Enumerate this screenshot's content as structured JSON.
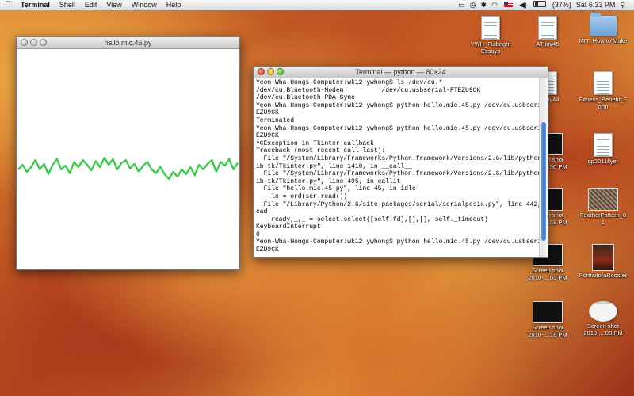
{
  "menubar": {
    "apple_glyph": "",
    "app_name": "Terminal",
    "menus": [
      "Shell",
      "Edit",
      "View",
      "Window",
      "Help"
    ],
    "battery": "(37%)",
    "clock": "Sat 6:33 PM"
  },
  "tk_window": {
    "title": "hello.mic.45.py",
    "waveform": [
      0.5,
      0.6,
      0.45,
      0.55,
      0.7,
      0.5,
      0.62,
      0.4,
      0.6,
      0.72,
      0.5,
      0.58,
      0.42,
      0.66,
      0.55,
      0.7,
      0.6,
      0.48,
      0.68,
      0.55,
      0.75,
      0.6,
      0.72,
      0.5,
      0.64,
      0.7,
      0.52,
      0.62,
      0.45,
      0.58,
      0.66,
      0.5,
      0.42,
      0.56,
      0.4,
      0.3,
      0.45,
      0.35,
      0.5,
      0.4,
      0.55,
      0.38,
      0.6,
      0.5,
      0.62,
      0.7,
      0.45,
      0.66,
      0.58,
      0.72,
      0.5,
      0.64
    ],
    "waveform_color": "#2ecc40"
  },
  "terminal": {
    "title": "Terminal — python — 80×24",
    "lines": [
      "Yeon-Wha-Hongs-Computer:wk12 ywhong$ ls /dev/cu.*",
      "/dev/cu.Bluetooth-Modem          /dev/cu.usbserial-FTEZU9CK",
      "/dev/cu.Bluetooth-PDA-Sync",
      "Yeon-Wha-Hongs-Computer:wk12 ywhong$ python hello.mic.45.py /dev/cu.usbserial-FT",
      "EZU9CK",
      "Terminated",
      "Yeon-Wha-Hongs-Computer:wk12 ywhong$ python hello.mic.45.py /dev/cu.usbserial-FT",
      "EZU9CK",
      "^CException in Tkinter callback",
      "Traceback (most recent call last):",
      "  File \"/System/Library/Frameworks/Python.framework/Versions/2.6/lib/python2.6/l",
      "ib-tk/Tkinter.py\", line 1410, in __call__",
      "  File \"/System/Library/Frameworks/Python.framework/Versions/2.6/lib/python2.6/l",
      "ib-tk/Tkinter.py\", line 495, in callit",
      "  File \"hello.mic.45.py\", line 45, in idle",
      "    lo = ord(ser.read())",
      "  File \"/Library/Python/2.6/site-packages/serial/serialposix.py\", line 442, in r",
      "ead",
      "    ready,_,_ = select.select([self.fd],[],[], self._timeout)",
      "KeyboardInterrupt",
      "0",
      "Yeon-Wha-Hongs-Computer:wk12 ywhong$ python hello.mic.45.py /dev/cu.usbserial-FT",
      "EZU9CK"
    ]
  },
  "desktop_icons": [
    {
      "name": "desktop-icon-ywh-fulbright-essays",
      "label": "YWH_Fulbright Essays",
      "kind": "doc"
    },
    {
      "name": "desktop-icon-attiny45",
      "label": "ATtiny45",
      "kind": "doc"
    },
    {
      "name": "desktop-icon-mit-how-to-make",
      "label": "MIT_How to Make",
      "kind": "folder"
    },
    {
      "name": "desktop-icon-attiny44",
      "label": "ATtiny44",
      "kind": "doc"
    },
    {
      "name": "desktop-icon-fitness-benefit-form",
      "label": "Fitness_Benefit_F orm",
      "kind": "doc"
    },
    {
      "name": "desktop-icon-screenshot-50pm",
      "label": "Screen shot 2010-....50 PM",
      "kind": "shot"
    },
    {
      "name": "desktop-icon-gp2011flyer",
      "label": "gp2011flyer",
      "kind": "doc"
    },
    {
      "name": "desktop-icon-screenshot-58pm",
      "label": "Screen shot 2010-....58 PM",
      "kind": "shot"
    },
    {
      "name": "desktop-icon-featherpattern",
      "label": "FeatherPattern_0 1",
      "kind": "photo-feather"
    },
    {
      "name": "desktop-icon-screenshot-03pm",
      "label": "Screen shot 2010-....03 PM",
      "kind": "shot"
    },
    {
      "name": "desktop-icon-portrait-rooster",
      "label": "PortraitofaRooster",
      "kind": "photo-rooster"
    },
    {
      "name": "desktop-icon-screenshot-18pm",
      "label": "Screen shot 2010-....18 PM",
      "kind": "shot"
    },
    {
      "name": "desktop-icon-screenshot-08pm",
      "label": "Screen shot 2010-....08 PM",
      "kind": "shot-light"
    }
  ]
}
